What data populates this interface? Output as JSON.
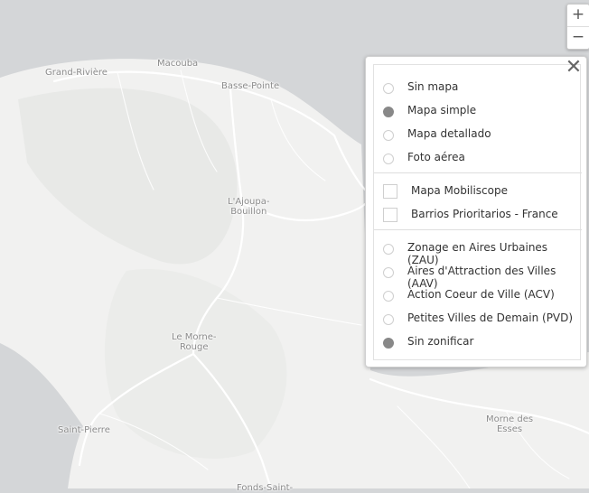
{
  "map": {
    "places": [
      {
        "id": "grand-riviere",
        "label": "Grand-Rivière"
      },
      {
        "id": "macouba",
        "label": "Macouba"
      },
      {
        "id": "basse-pointe",
        "label": "Basse-Pointe"
      },
      {
        "id": "ajoupa-bouillon",
        "label": "L'Ajoupa-\nBouillon"
      },
      {
        "id": "morne-rouge",
        "label": "Le Morne-\nRouge"
      },
      {
        "id": "saint-pierre",
        "label": "Saint-Pierre"
      },
      {
        "id": "morne-des-esses",
        "label": "Morne des\nEsses"
      },
      {
        "id": "fonds-saint",
        "label": "Fonds-Saint-"
      }
    ]
  },
  "zoom": {
    "in_label": "+",
    "out_label": "−"
  },
  "layers_panel": {
    "close_label": "✕",
    "basemaps": [
      {
        "label": "Sin mapa",
        "selected": false
      },
      {
        "label": "Mapa simple",
        "selected": true
      },
      {
        "label": "Mapa detallado",
        "selected": false
      },
      {
        "label": "Foto aérea",
        "selected": false
      }
    ],
    "overlays": [
      {
        "label": "Mapa Mobiliscope",
        "checked": false
      },
      {
        "label": "Barrios Prioritarios - France",
        "checked": false
      }
    ],
    "zonings": [
      {
        "label": "Zonage en Aires Urbaines (ZAU)",
        "selected": false
      },
      {
        "label": "Aires d'Attraction des Villes (AAV)",
        "selected": false
      },
      {
        "label": "Action Coeur de Ville (ACV)",
        "selected": false
      },
      {
        "label": "Petites Villes de Demain (PVD)",
        "selected": false
      },
      {
        "label": "Sin zonificar",
        "selected": true
      }
    ]
  },
  "colors": {
    "sea": "#d4d6d8",
    "land": "#f1f1f0",
    "road": "#ffffff",
    "relief": "#e3e4e2"
  }
}
